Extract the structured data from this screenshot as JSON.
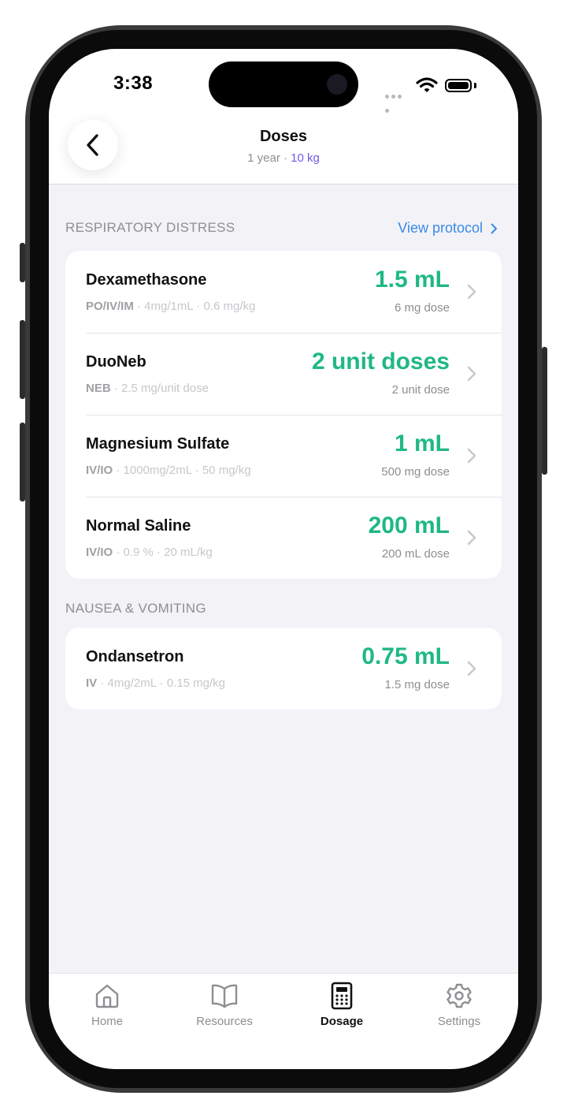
{
  "status": {
    "time": "3:38"
  },
  "header": {
    "title": "Doses",
    "age": "1 year",
    "separator": "·",
    "weight": "10 kg"
  },
  "colors": {
    "accent_green": "#1fb883",
    "link_blue": "#3b8ae6",
    "weight_purple": "#6c5ce7"
  },
  "sections": [
    {
      "label": "RESPIRATORY DISTRESS",
      "link": "View protocol",
      "items": [
        {
          "name": "Dexamethasone",
          "route": "PO/IV/IM",
          "detail": " · 4mg/1mL · 0.6 mg/kg",
          "volume": "1.5 mL",
          "dose": "6 mg dose"
        },
        {
          "name": "DuoNeb",
          "route": "NEB",
          "detail": " · 2.5 mg/unit dose",
          "volume": "2 unit doses",
          "dose": "2 unit dose"
        },
        {
          "name": "Magnesium Sulfate",
          "route": "IV/IO",
          "detail": " · 1000mg/2mL · 50 mg/kg",
          "volume": "1 mL",
          "dose": "500 mg dose"
        },
        {
          "name": "Normal Saline",
          "route": "IV/IO",
          "detail": " · 0.9 % · 20 mL/kg",
          "volume": "200 mL",
          "dose": "200 mL dose"
        }
      ]
    },
    {
      "label": "NAUSEA & VOMITING",
      "items": [
        {
          "name": "Ondansetron",
          "route": "IV",
          "detail": " · 4mg/2mL · 0.15 mg/kg",
          "volume": "0.75 mL",
          "dose": "1.5 mg dose"
        }
      ]
    }
  ],
  "tabs": [
    {
      "label": "Home",
      "icon": "home-icon"
    },
    {
      "label": "Resources",
      "icon": "book-icon"
    },
    {
      "label": "Dosage",
      "icon": "calculator-icon",
      "active": true
    },
    {
      "label": "Settings",
      "icon": "gear-icon"
    }
  ]
}
